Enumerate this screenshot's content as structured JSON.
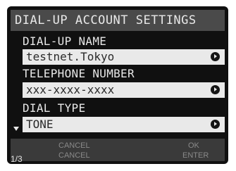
{
  "title": "DIAL-UP ACCOUNT SETTINGS",
  "fields": [
    {
      "label": "DIAL-UP NAME",
      "value": "testnet.Tokyo"
    },
    {
      "label": "TELEPHONE NUMBER",
      "value": "xxx-xxxx-xxxx"
    },
    {
      "label": "DIAL TYPE",
      "value": "TONE"
    }
  ],
  "bottom_bar": {
    "page": "1/3",
    "left_top": "CANCEL",
    "left_bottom": "CANCEL",
    "right_top": "OK",
    "right_bottom": "ENTER"
  },
  "icons": {
    "field_arrow": "right-arrow-circle-icon",
    "scroll": "scroll-down-triangle-icon"
  },
  "colors": {
    "screen_bg": "#101010",
    "title_bar": "#4a4a4a",
    "field_bg": "#e9e9e9",
    "bottom_bar": "#3a3a3a"
  }
}
